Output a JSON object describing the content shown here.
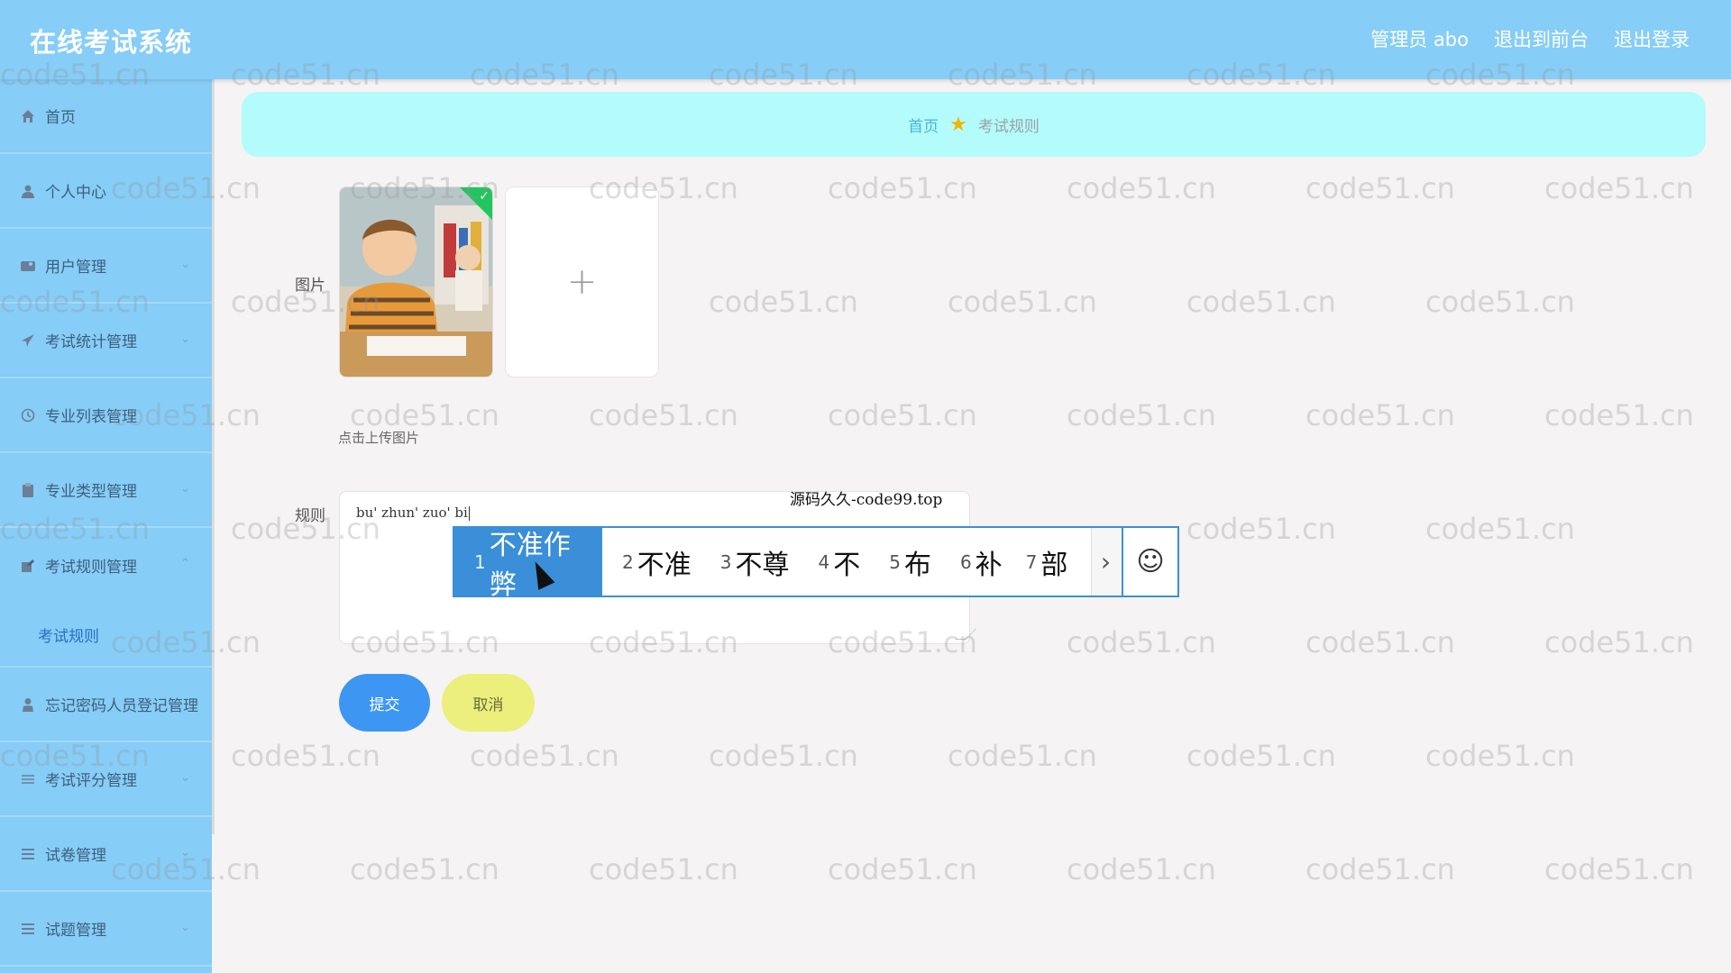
{
  "header": {
    "title": "在线考试系统",
    "admin_label": "管理员 abo",
    "to_frontend": "退出到前台",
    "logout": "退出登录"
  },
  "sidebar": {
    "items": [
      {
        "label": "首页",
        "icon": "home-icon"
      },
      {
        "label": "个人中心",
        "icon": "user-icon"
      },
      {
        "label": "用户管理",
        "icon": "users-icon"
      },
      {
        "label": "考试统计管理",
        "icon": "send-icon"
      },
      {
        "label": "专业列表管理",
        "icon": "clock-icon"
      },
      {
        "label": "专业类型管理",
        "icon": "clipboard-icon"
      },
      {
        "label": "考试规则管理",
        "icon": "edit-icon",
        "sub": "考试规则"
      },
      {
        "label": "忘记密码人员登记管理",
        "icon": "person-icon"
      },
      {
        "label": "考试评分管理",
        "icon": "sliders-icon"
      },
      {
        "label": "试卷管理",
        "icon": "list-icon"
      },
      {
        "label": "试题管理",
        "icon": "list-icon"
      }
    ]
  },
  "breadcrumb": {
    "home": "首页",
    "current": "考试规则"
  },
  "form": {
    "image_label": "图片",
    "upload_hint": "点击上传图片",
    "rules_label": "规则",
    "rules_input_text": "bu' zhun' zuo' bi",
    "submit_label": "提交",
    "cancel_label": "取消"
  },
  "ime": {
    "source_text": "源码久久-code99.top",
    "candidates": [
      {
        "num": "1",
        "text": "不准作弊"
      },
      {
        "num": "2",
        "text": "不准"
      },
      {
        "num": "3",
        "text": "不尊"
      },
      {
        "num": "4",
        "text": "不"
      },
      {
        "num": "5",
        "text": "布"
      },
      {
        "num": "6",
        "text": "补"
      },
      {
        "num": "7",
        "text": "部"
      }
    ]
  },
  "watermark": {
    "text": "code51.cn"
  },
  "colors": {
    "header_bg": "#86cdf7",
    "breadcrumb_bg": "#b4fbfb",
    "submit_bg": "#3d97f2",
    "cancel_bg": "#ecef7b",
    "ime_selected": "#3a8fd8"
  }
}
